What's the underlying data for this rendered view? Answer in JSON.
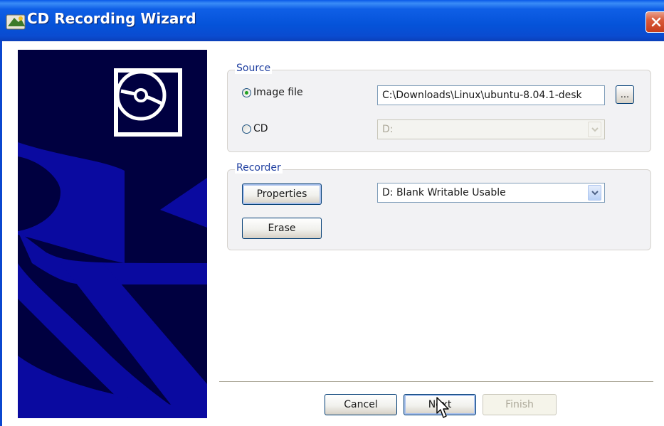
{
  "window": {
    "title": "CD Recording Wizard"
  },
  "source": {
    "legend": "Source",
    "image_file_label": "Image file",
    "image_file_selected": true,
    "image_path": "C:\\Downloads\\Linux\\ubuntu-8.04.1-desk",
    "browse_label": "...",
    "cd_label": "CD",
    "cd_selected": false,
    "cd_drive": "D:"
  },
  "recorder": {
    "legend": "Recorder",
    "properties_label": "Properties",
    "erase_label": "Erase",
    "drive": "D: Blank Writable Usable"
  },
  "footer": {
    "cancel_label": "Cancel",
    "next_label": "Next",
    "finish_label": "Finish"
  },
  "colors": {
    "titlebar": "#0553d9",
    "banner_bg": "#000040",
    "banner_shape": "#0a0aa0",
    "legend_text": "#1f3fa0",
    "close_button": "#d95a3a"
  },
  "icons": [
    "cd-wizard-app-icon",
    "close-icon",
    "cd-disc-icon",
    "chevron-down-icon",
    "mouse-cursor-icon"
  ]
}
